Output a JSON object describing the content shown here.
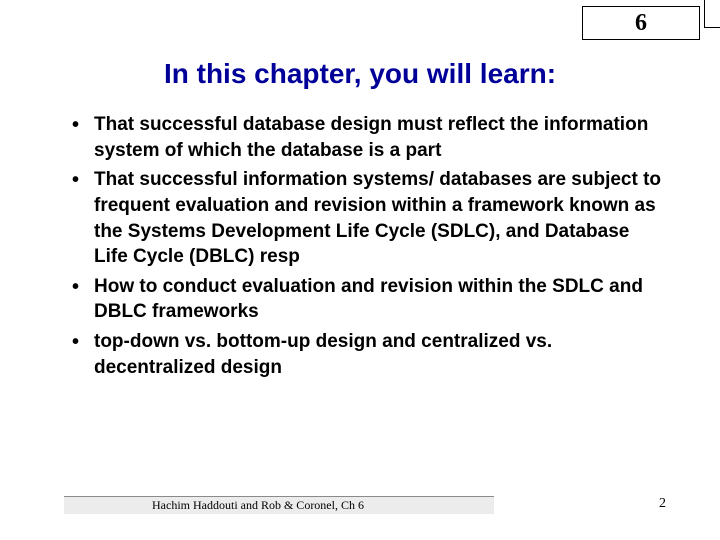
{
  "chapter_number": "6",
  "title": "In this chapter, you will learn:",
  "bullets": [
    "That successful database design must reflect the information system of which the database is a part",
    "That successful information systems/ databases are subject to frequent evaluation and revision within a framework known as the Systems Development Life Cycle (SDLC), and Database Life Cycle (DBLC) resp",
    "How to conduct evaluation and revision within the SDLC and DBLC frameworks",
    "top-down vs. bottom-up design and centralized vs. decentralized design"
  ],
  "footer_text": "Hachim Haddouti and  Rob & Coronel, Ch 6",
  "page_number": "2"
}
